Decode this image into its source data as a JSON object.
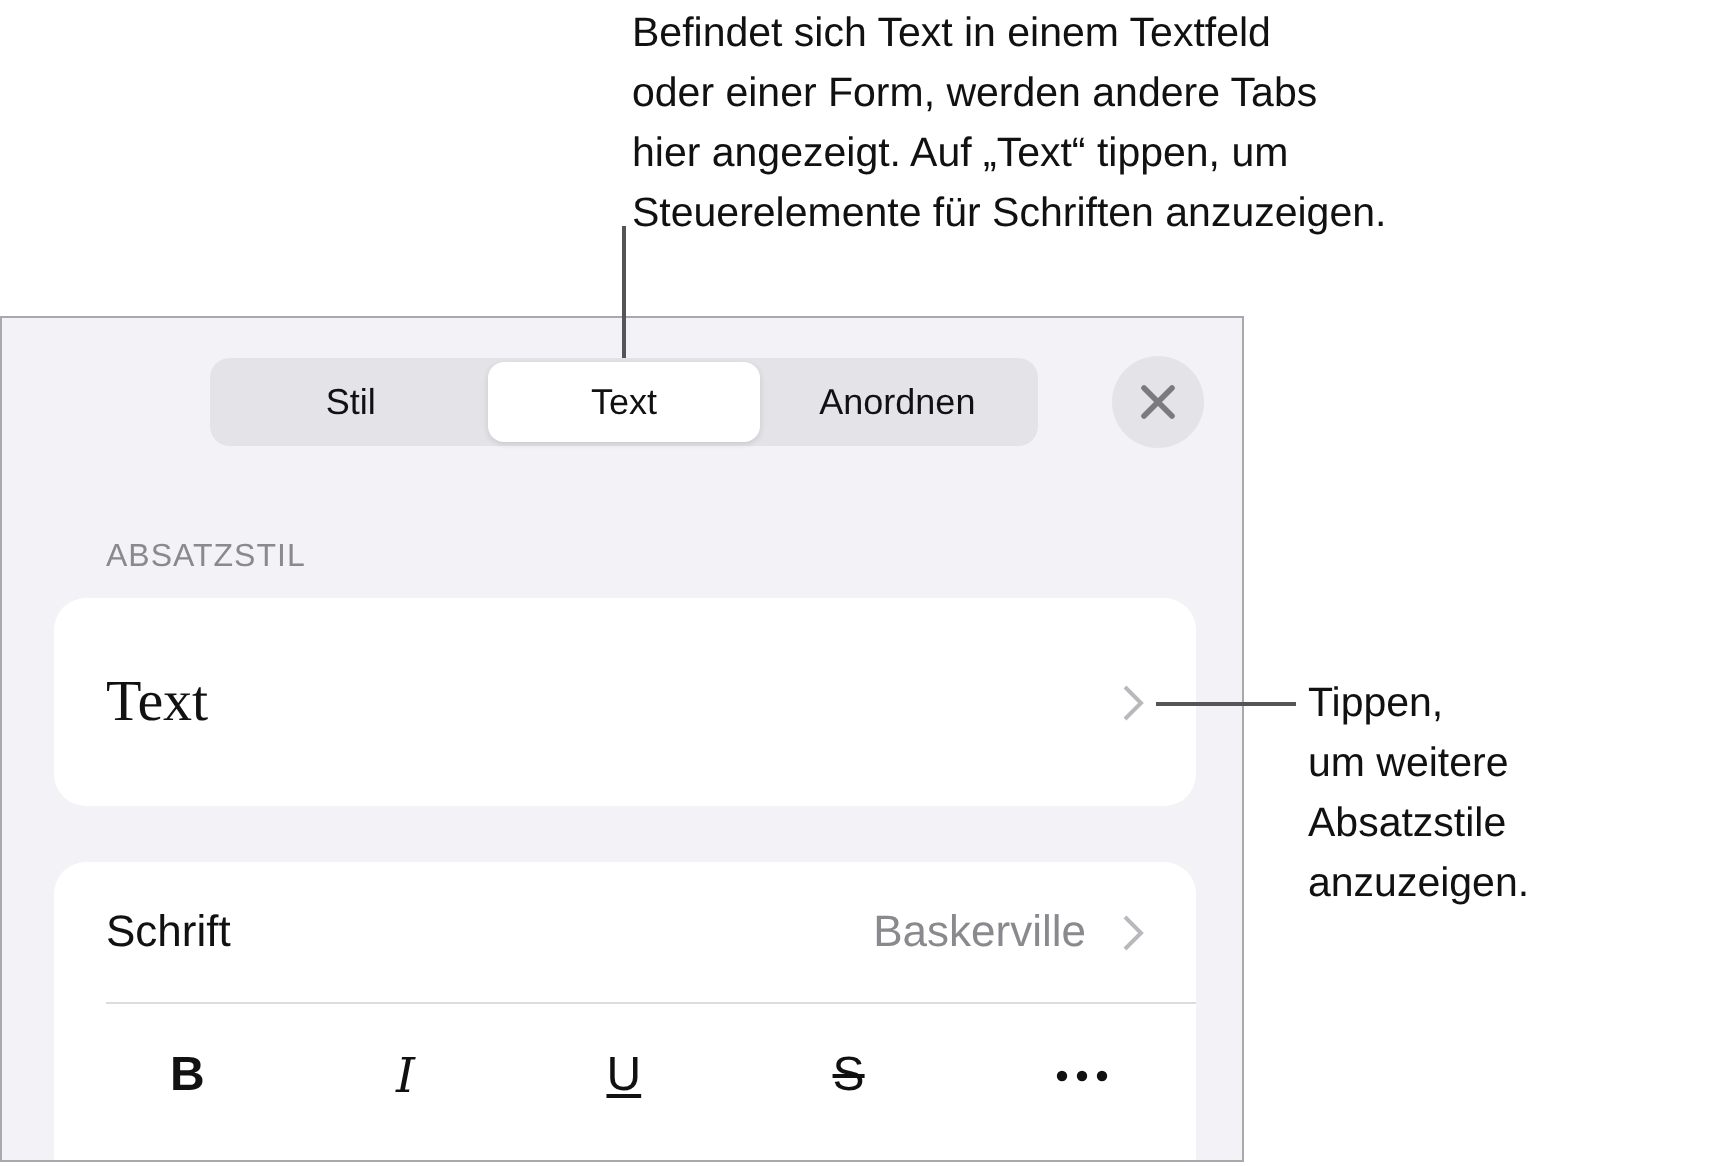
{
  "callouts": [
    {
      "text": "Befindet sich Text in einem Textfeld\noder einer Form, werden andere Tabs\nhier angezeigt. Auf „Text“ tippen, um\nSteuerelemente für Schriften anzuzeigen."
    },
    {
      "text": "Tippen,\num weitere\nAbsatzstile\nanzuzeigen."
    }
  ],
  "tabs": [
    {
      "label": "Stil",
      "selected": false
    },
    {
      "label": "Text",
      "selected": true
    },
    {
      "label": "Anordnen",
      "selected": false
    }
  ],
  "section_header": "ABSATZSTIL",
  "paragraph_style": {
    "value": "Text"
  },
  "font_row": {
    "label": "Schrift",
    "value": "Baskerville"
  },
  "format_buttons": [
    {
      "label": "B",
      "kind": "bold"
    },
    {
      "label": "I",
      "kind": "italic"
    },
    {
      "label": "U",
      "kind": "underline"
    },
    {
      "label": "S",
      "kind": "strike"
    }
  ]
}
